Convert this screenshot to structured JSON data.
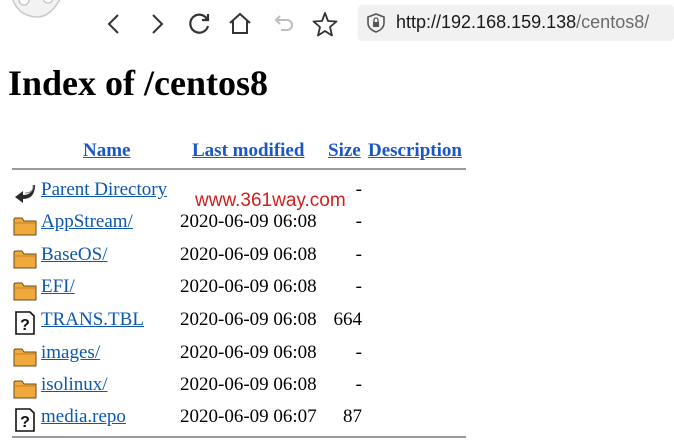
{
  "browser": {
    "url_host": "http://192.168.159.138",
    "url_path": "/centos8/"
  },
  "page": {
    "title": "Index of /centos8",
    "columns": {
      "name": "Name",
      "last_modified": "Last modified",
      "size": "Size",
      "description": "Description"
    },
    "rows": [
      {
        "name": "Parent Directory",
        "modified": "",
        "size": "-",
        "icon": "back-icon"
      },
      {
        "name": "AppStream/",
        "modified": "2020-06-09 06:08",
        "size": "-",
        "icon": "folder-icon"
      },
      {
        "name": "BaseOS/",
        "modified": "2020-06-09 06:08",
        "size": "-",
        "icon": "folder-icon"
      },
      {
        "name": "EFI/",
        "modified": "2020-06-09 06:08",
        "size": "-",
        "icon": "folder-icon"
      },
      {
        "name": "TRANS.TBL",
        "modified": "2020-06-09 06:08",
        "size": "664",
        "icon": "unknown-file-icon"
      },
      {
        "name": "images/",
        "modified": "2020-06-09 06:08",
        "size": "-",
        "icon": "folder-icon"
      },
      {
        "name": "isolinux/",
        "modified": "2020-06-09 06:08",
        "size": "-",
        "icon": "folder-icon"
      },
      {
        "name": "media.repo",
        "modified": "2020-06-09 06:07",
        "size": "87",
        "icon": "unknown-file-icon"
      }
    ],
    "watermark": "www.361way.com"
  },
  "colors": {
    "link": "#0b57b0",
    "watermark": "#d11f1f",
    "folder": "#e8a33a"
  }
}
